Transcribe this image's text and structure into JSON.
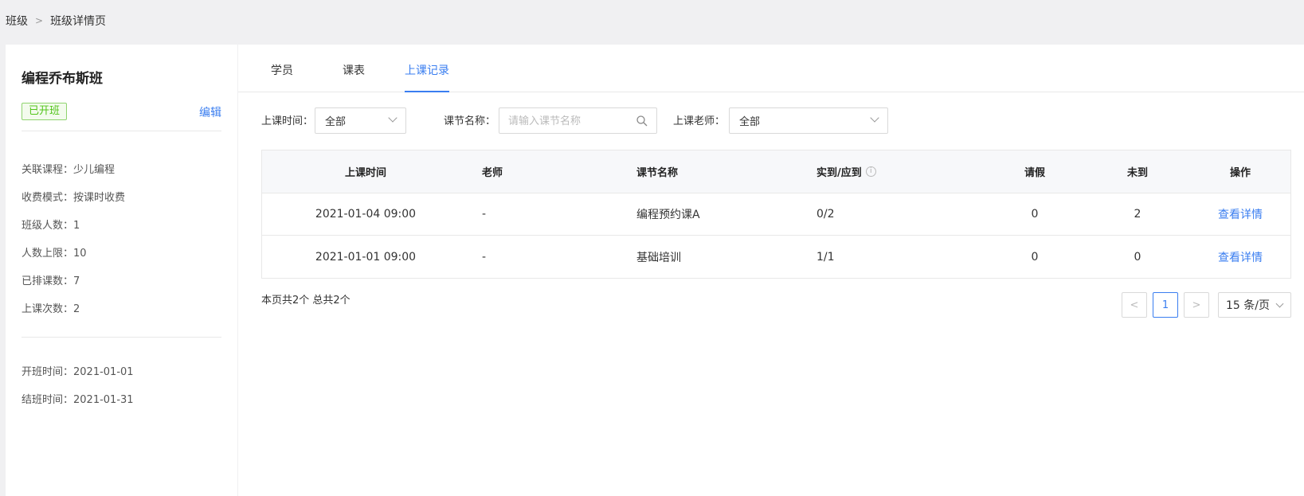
{
  "breadcrumb": {
    "items": [
      "班级",
      "班级详情页"
    ],
    "separator": ">"
  },
  "class_info": {
    "title": "编程乔布斯班",
    "status": "已开班",
    "edit_label": "编辑",
    "details": [
      "关联课程：少儿编程",
      "收费模式：按课时收费",
      "班级人数：1",
      "人数上限：10",
      "已排课数：7",
      "上课次数：2"
    ],
    "dates": [
      "开班时间：2021-01-01",
      "结班时间：2021-01-31"
    ]
  },
  "tabs": [
    {
      "label": "学员",
      "active": false
    },
    {
      "label": "课表",
      "active": false
    },
    {
      "label": "上课记录",
      "active": true
    }
  ],
  "filters": {
    "time_label": "上课时间：",
    "time_value": "全部",
    "lesson_label": "课节名称：",
    "lesson_placeholder": "请输入课节名称",
    "teacher_label": "上课老师：",
    "teacher_value": "全部"
  },
  "table": {
    "headers": [
      "上课时间",
      "老师",
      "课节名称",
      "实到/应到",
      "请假",
      "未到",
      "操作"
    ],
    "rows": [
      {
        "time": "2021-01-04 09:00",
        "teacher": "-",
        "lesson": "编程预约课A",
        "attendance": "0/2",
        "leave": "0",
        "absent": "2",
        "action": "查看详情"
      },
      {
        "time": "2021-01-01 09:00",
        "teacher": "-",
        "lesson": "基础培训",
        "attendance": "1/1",
        "leave": "0",
        "absent": "0",
        "action": "查看详情"
      }
    ]
  },
  "pagination": {
    "summary": "本页共2个 总共2个",
    "prev": "<",
    "current": "1",
    "next": ">",
    "page_size": "15 条/页"
  },
  "colors": {
    "accent": "#3a7ef0",
    "success": "#52c41a"
  }
}
